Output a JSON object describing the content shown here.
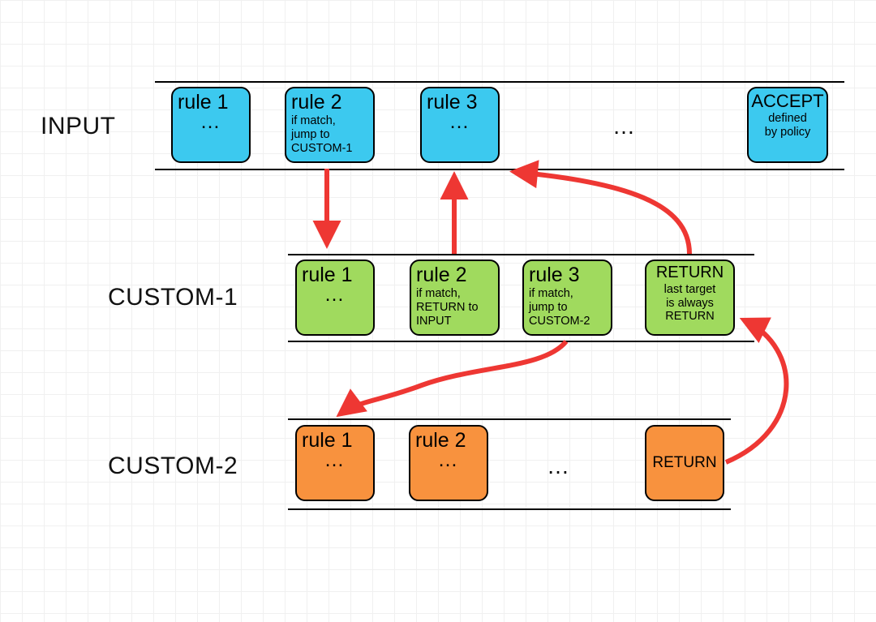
{
  "colors": {
    "arrow": "#ee3733",
    "blue": "#3cc9ef",
    "green": "#a0da5e",
    "orange": "#f8923e"
  },
  "labels": {
    "input": "INPUT",
    "custom1": "CUSTOM-1",
    "custom2": "CUSTOM-2"
  },
  "ellipsis": "…",
  "boxes": {
    "input_rule1": {
      "title": "rule 1",
      "more": "…"
    },
    "input_rule2": {
      "title": "rule 2",
      "sub": "if match,\njump to\nCUSTOM-1"
    },
    "input_rule3": {
      "title": "rule 3",
      "more": "…"
    },
    "input_accept": {
      "title": "ACCEPT",
      "sub": "defined\nby policy"
    },
    "c1_rule1": {
      "title": "rule 1",
      "more": "…"
    },
    "c1_rule2": {
      "title": "rule 2",
      "sub": "if match,\nRETURN to\nINPUT"
    },
    "c1_rule3": {
      "title": "rule 3",
      "sub": "if match,\njump to\nCUSTOM-2"
    },
    "c1_return": {
      "title": "RETURN",
      "sub": "last target\nis always\nRETURN"
    },
    "c2_rule1": {
      "title": "rule 1",
      "more": "…"
    },
    "c2_rule2": {
      "title": "rule 2",
      "more": "…"
    },
    "c2_return": {
      "title": "RETURN"
    }
  }
}
